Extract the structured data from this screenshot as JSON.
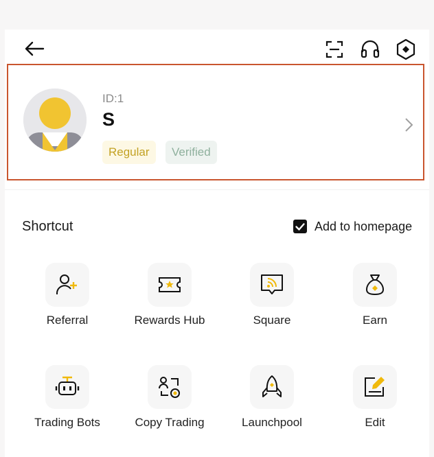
{
  "header": {
    "back_icon": "arrow-left-icon",
    "scan_icon": "scan-icon",
    "support_icon": "headset-icon",
    "settings_icon": "hexagon-settings-icon"
  },
  "profile": {
    "id_text": "ID:1",
    "name": "S",
    "badges": [
      "Regular",
      "Verified"
    ],
    "avatar_icon": "default-avatar-icon",
    "chevron_icon": "chevron-right-icon"
  },
  "shortcut": {
    "title": "Shortcut",
    "add_to_homepage_label": "Add to homepage",
    "add_to_homepage_checked": true,
    "items": [
      {
        "label": "Referral",
        "icon": "add-user-icon"
      },
      {
        "label": "Rewards Hub",
        "icon": "ticket-star-icon"
      },
      {
        "label": "Square",
        "icon": "broadcast-chat-icon"
      },
      {
        "label": "Earn",
        "icon": "money-bag-icon"
      },
      {
        "label": "Trading Bots",
        "icon": "robot-icon"
      },
      {
        "label": "Copy Trading",
        "icon": "copy-trading-icon"
      },
      {
        "label": "Launchpool",
        "icon": "rocket-icon"
      },
      {
        "label": "Edit",
        "icon": "edit-icon"
      }
    ]
  },
  "colors": {
    "accent": "#f0b90b",
    "highlight_border": "#c9552e",
    "regular_badge_text": "#c3a224",
    "verified_badge_text": "#8fb09d"
  }
}
